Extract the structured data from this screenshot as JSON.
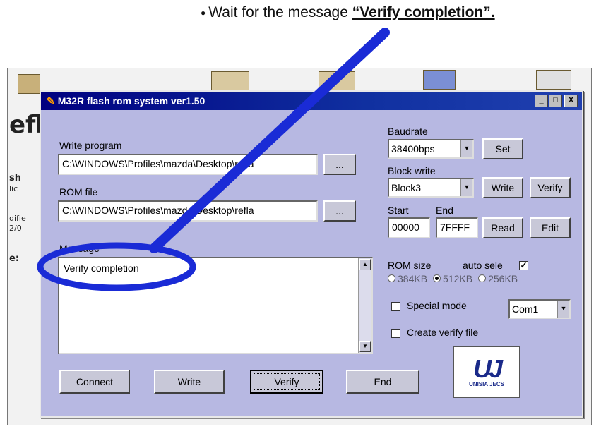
{
  "instruction": {
    "prefix": "Wait for the message ",
    "emphasis": "“Verify completion”."
  },
  "background": {
    "partial_texts": [
      "efl",
      "sh",
      "lic",
      "difie",
      "2/0",
      "e:"
    ]
  },
  "window": {
    "title": "M32R flash rom system ver1.50",
    "controls": {
      "minimize": "_",
      "maximize": "□",
      "close": "X"
    }
  },
  "write_program": {
    "label": "Write program",
    "value": "C:\\WINDOWS\\Profiles\\mazda\\Desktop\\refla",
    "browse_label": "..."
  },
  "rom_file": {
    "label": "ROM file",
    "value": "C:\\WINDOWS\\Profiles\\mazda\\Desktop\\refla",
    "browse_label": "..."
  },
  "message": {
    "label": "Message",
    "text": "Verify completion"
  },
  "baudrate": {
    "label": "Baudrate",
    "value": "38400bps",
    "set_label": "Set"
  },
  "block_write": {
    "label": "Block write",
    "value": "Block3",
    "write_label": "Write",
    "verify_label": "Verify"
  },
  "address": {
    "start_label": "Start",
    "end_label": "End",
    "start_value": "00000",
    "end_value": "7FFFF",
    "read_label": "Read",
    "edit_label": "Edit"
  },
  "rom_size": {
    "label": "ROM size",
    "auto_label": "auto sele",
    "auto_checked": true,
    "options": [
      "384KB",
      "512KB",
      "256KB"
    ],
    "selected": "512KB"
  },
  "special_mode": {
    "label": "Special mode",
    "checked": false
  },
  "com_port": {
    "value": "Com1"
  },
  "create_verify": {
    "label": "Create verify file",
    "checked": false
  },
  "buttons": {
    "connect": "Connect",
    "write": "Write",
    "verify": "Verify",
    "end": "End"
  },
  "logo": {
    "brand": "UNISIA JECS"
  },
  "annotation": {
    "color": "#1a2bd6"
  }
}
